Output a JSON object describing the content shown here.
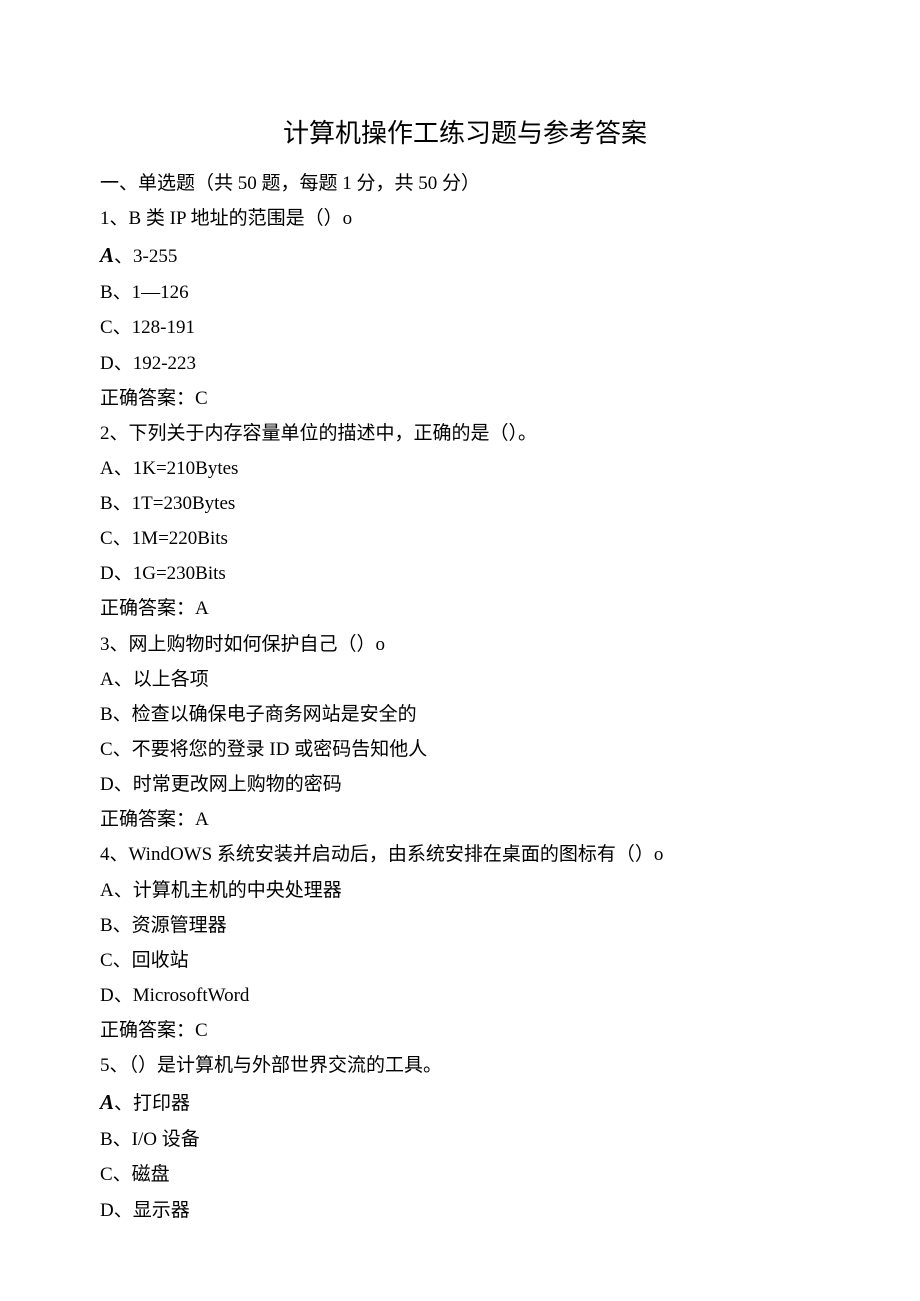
{
  "title": "计算机操作工练习题与参考答案",
  "section": "一、单选题（共 50 题，每题 1 分，共 50 分）",
  "q1": {
    "stem": "1、B 类 IP 地址的范围是（）o",
    "a_label": "A",
    "a_sep": "、",
    "a": "3-255",
    "b": "B、1—126",
    "c": "C、128-191",
    "d": "D、192-223",
    "ans": "正确答案：C"
  },
  "q2": {
    "stem": "2、下列关于内存容量单位的描述中，正确的是（）。",
    "a": "A、1K=210Bytes",
    "b": "B、1T=230Bytes",
    "c": "C、1M=220Bits",
    "d": "D、1G=230Bits",
    "ans": "正确答案：A"
  },
  "q3": {
    "stem": "3、网上购物时如何保护自己（）o",
    "a": "A、以上各项",
    "b": "B、检查以确保电子商务网站是安全的",
    "c": "C、不要将您的登录 ID 或密码告知他人",
    "d": "D、时常更改网上购物的密码",
    "ans": "正确答案：A"
  },
  "q4": {
    "stem": "4、WindOWS 系统安装并启动后，由系统安排在桌面的图标有（）o",
    "a": "A、计算机主机的中央处理器",
    "b": "B、资源管理器",
    "c": "C、回收站",
    "d": "D、MicrosoftWord",
    "ans": "正确答案：C"
  },
  "q5": {
    "stem": "5、（）是计算机与外部世界交流的工具。",
    "a_label": "A",
    "a_sep": "、",
    "a": "打印器",
    "b": "B、I/O 设备",
    "c": "C、磁盘",
    "d": "D、显示器"
  }
}
